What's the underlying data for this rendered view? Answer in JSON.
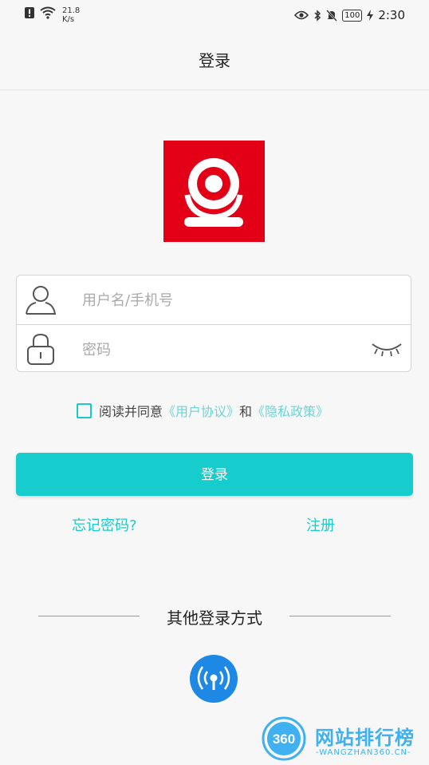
{
  "status_bar": {
    "speed_value": "21.8",
    "speed_unit": "K/s",
    "battery": "100",
    "time": "2:30"
  },
  "header": {
    "title": "登录"
  },
  "form": {
    "username_placeholder": "用户名/手机号",
    "password_placeholder": "密码",
    "username_value": "",
    "password_value": ""
  },
  "agreement": {
    "prefix": "阅读并同意",
    "user_agreement": "《用户协议》",
    "and": "和",
    "privacy_policy": "《隐私政策》",
    "checked": false
  },
  "login_button": "登录",
  "forgot_password": "忘记密码?",
  "register": "注册",
  "other_login": {
    "title": "其他登录方式"
  },
  "watermark": {
    "brand": "网站排行榜",
    "number": "360",
    "url": "-WANGZHAN360.CN-"
  },
  "colors": {
    "accent": "#16cccc",
    "logo_red": "#e30016",
    "other_login_blue": "#1e88e5",
    "watermark_blue": "#3fb0f0"
  },
  "icons": {
    "username": "user-icon",
    "password": "lock-icon",
    "toggle_password": "eye-closed-icon",
    "other_login": "hotspot-icon"
  }
}
